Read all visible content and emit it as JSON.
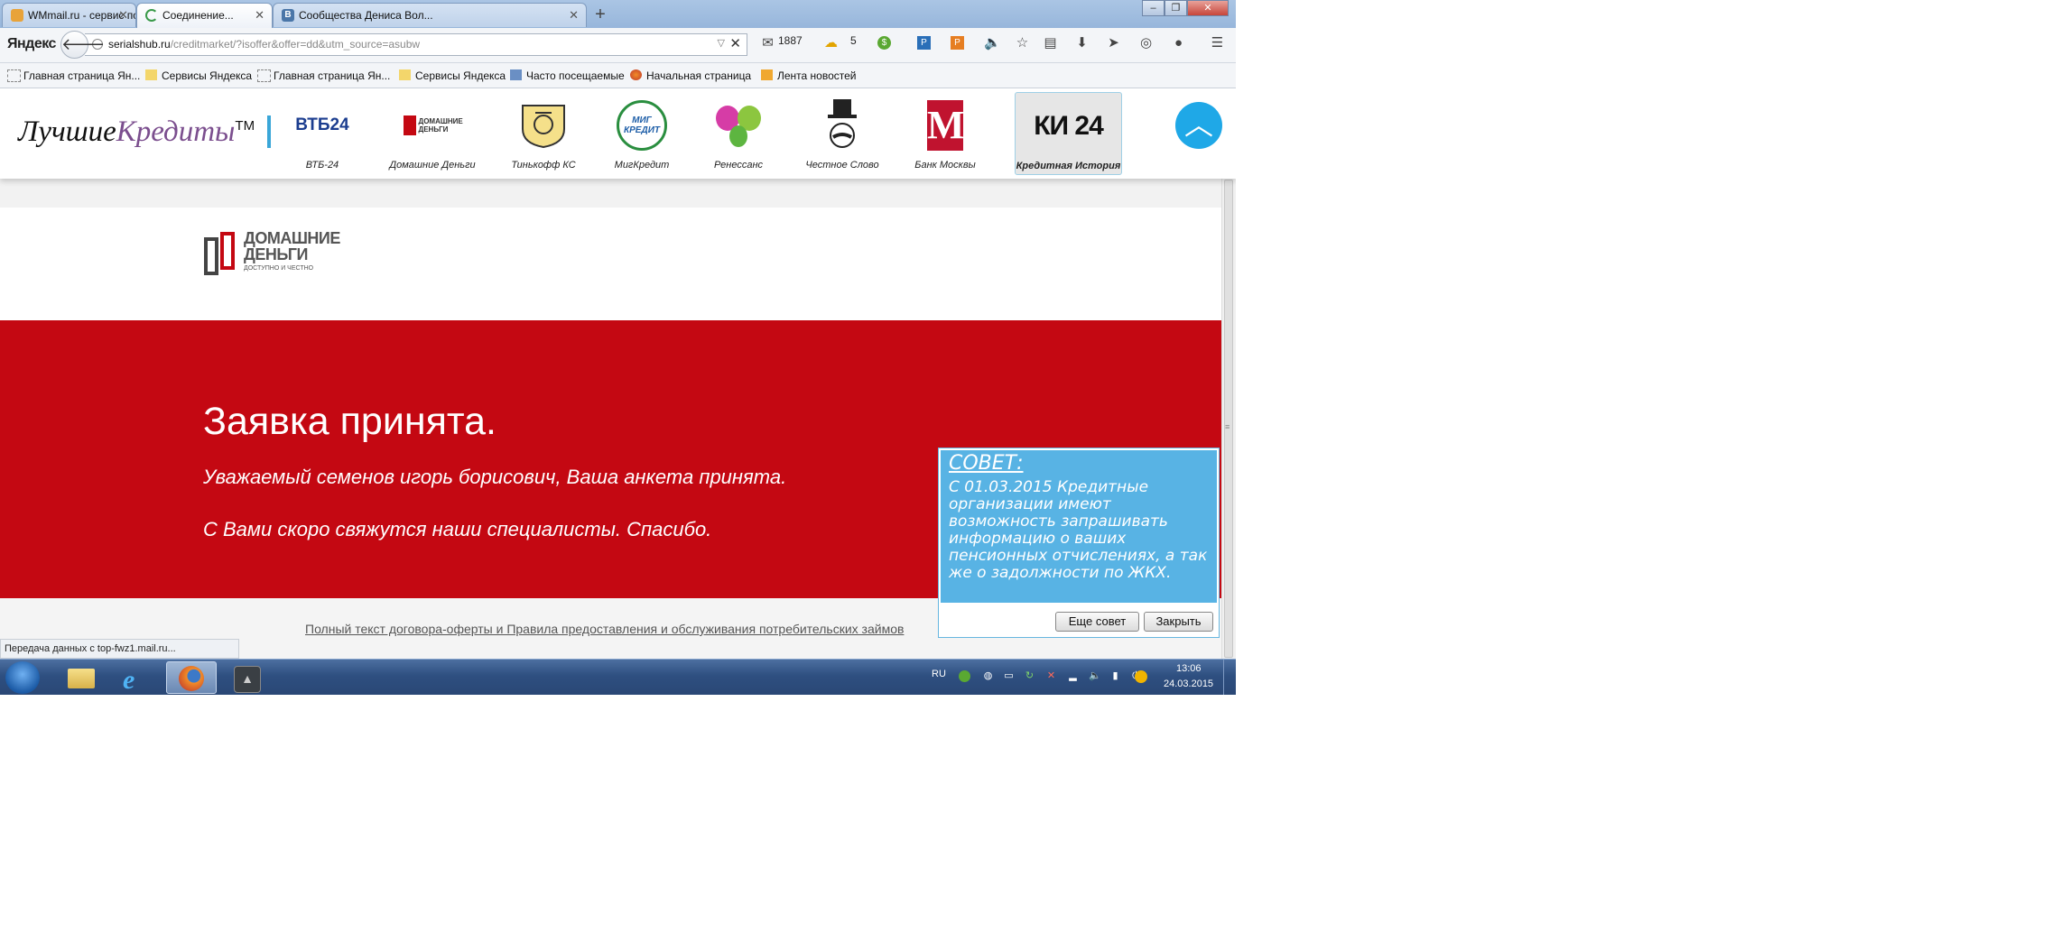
{
  "browser": {
    "tabs": [
      {
        "title": "WMmail.ru - сервис почт...",
        "icon": "wmmail-icon"
      },
      {
        "title": "Соединение...",
        "icon": "loading-spinner-icon"
      },
      {
        "title": "Сообщества Дениса Вол...",
        "icon": "vk-icon"
      }
    ],
    "new_tab": "+",
    "toolbar": {
      "yandex_logo": "Яндекс",
      "url_host": "serialshub.ru",
      "url_path": "/creditmarket/?isoffer&offer=dd&utm_source=asubw",
      "mail_count": "1887",
      "weather_temp": "5"
    },
    "bookmarks": [
      "Главная страница Ян...",
      "Сервисы Яндекса",
      "Главная страница Ян...",
      "Сервисы Яндекса",
      "Часто посещаемые",
      "Начальная страница",
      "Лента новостей"
    ]
  },
  "site": {
    "logo_part1": "Лучшие",
    "logo_part2": "Кредиты",
    "logo_tm": "TM",
    "lenders": [
      {
        "name": "ВТБ-24",
        "mark": "ВТБ24"
      },
      {
        "name": "Домашние Деньги",
        "mark": "ДОМАШНИЕ ДЕНЬГИ"
      },
      {
        "name": "Тинькофф КС",
        "mark": ""
      },
      {
        "name": "МигКредит",
        "mark": "МИГ КРЕДИТ"
      },
      {
        "name": "Ренессанс",
        "mark": ""
      },
      {
        "name": "Честное Слово",
        "mark": ""
      },
      {
        "name": "Банк Москвы",
        "mark": "М"
      },
      {
        "name": "Кредитная История",
        "mark": "КИ 24"
      }
    ],
    "scroll_top_icon": "chevron-up-icon",
    "brand_logo_line1": "ДОМАШНИЕ",
    "brand_logo_line2": "ДЕНЬГИ",
    "brand_logo_tagline": "ДОСТУПНО И ЧЕСТНО",
    "success_title": "Заявка принята.",
    "success_message": "Уважаемый семенов игорь борисович, Ваша анкета принята.",
    "success_contact": "С Вами скоро свяжутся наши специалисты. Спасибо.",
    "offer_link": "Полный текст договора-оферты и Правила предоставления и обслуживания потребительских займов",
    "tip": {
      "title": "СОВЕТ:",
      "text": "С 01.03.2015 Кредитные организации имеют возможность запрашивать информацию о ваших пенсионных отчислениях, а так же о задолжности по ЖКХ.",
      "more_button": "Еще совет",
      "close_button": "Закрыть"
    },
    "colors": {
      "red_panel": "#c40812",
      "tip_blue": "#58b3e4",
      "accent_blue": "#1fa8e7",
      "logo_purple": "#7b4e8e"
    }
  },
  "status_bar": "Передача данных с top-fwz1.mail.ru...",
  "taskbar": {
    "language": "RU",
    "time": "13:06",
    "date": "24.03.2015"
  }
}
